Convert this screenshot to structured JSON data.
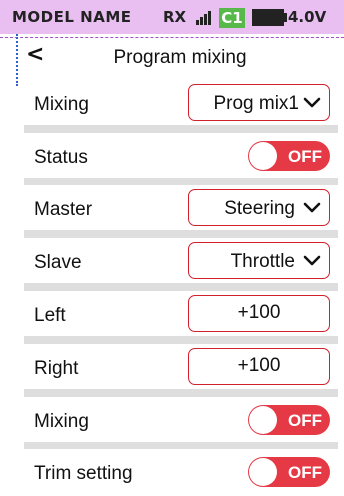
{
  "status_bar": {
    "model_name": "MODEL NAME",
    "rx_label": "RX",
    "signal_icon": "signal-bars-icon",
    "channel_badge": "C1",
    "battery_icon": "battery-icon",
    "voltage": "4.0V"
  },
  "header": {
    "back_icon": "chevron-left-icon",
    "back_glyph": "<",
    "title": "Program mixing"
  },
  "rows": {
    "mixing_select": {
      "label": "Mixing",
      "value": "Prog mix1"
    },
    "status": {
      "label": "Status",
      "state": "OFF"
    },
    "master": {
      "label": "Master",
      "value": "Steering"
    },
    "slave": {
      "label": "Slave",
      "value": "Throttle"
    },
    "left": {
      "label": "Left",
      "value": "+100"
    },
    "right": {
      "label": "Right",
      "value": "+100"
    },
    "mixing_toggle": {
      "label": "Mixing",
      "state": "OFF"
    },
    "trim_setting": {
      "label": "Trim setting",
      "state": "OFF"
    }
  },
  "colors": {
    "status_bar_bg": "#e8bff0",
    "accent_red": "#e63946",
    "badge_green": "#58b94a",
    "list_bg": "#dedede"
  }
}
